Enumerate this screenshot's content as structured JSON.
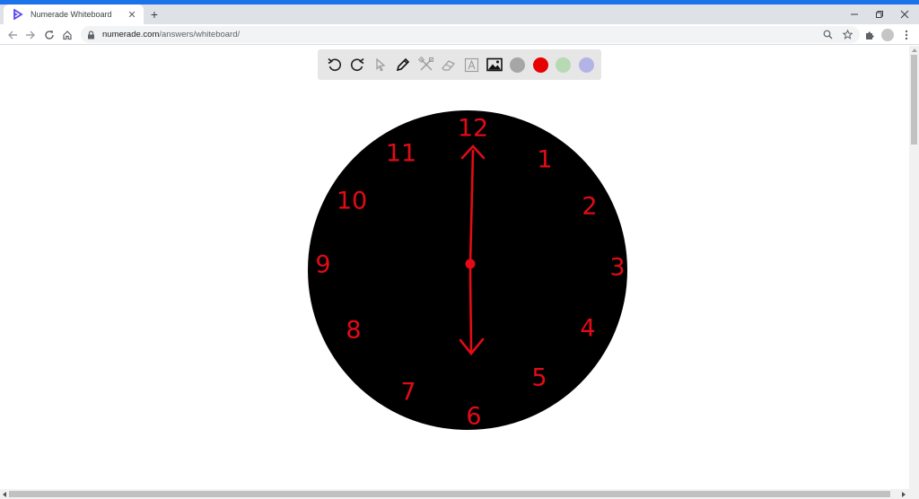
{
  "browser": {
    "tab_title": "Numerade Whiteboard",
    "url_host": "numerade.com",
    "url_path": "/answers/whiteboard/",
    "accent_color": "#1a73e8"
  },
  "toolbar": {
    "tools": [
      "undo-icon",
      "redo-icon",
      "pointer-icon",
      "pen-icon",
      "tools-icon",
      "eraser-icon",
      "text-icon",
      "image-icon"
    ],
    "colors": [
      "#a6a6a6",
      "#e60000",
      "#b7d9b3",
      "#b3b3e6"
    ]
  },
  "clock": {
    "face_color": "#000000",
    "ink_color": "#e30b17",
    "numbers": [
      "12",
      "1",
      "2",
      "3",
      "4",
      "5",
      "6",
      "7",
      "8",
      "9",
      "10",
      "11"
    ],
    "hand_from": "12",
    "hand_to": "6"
  }
}
